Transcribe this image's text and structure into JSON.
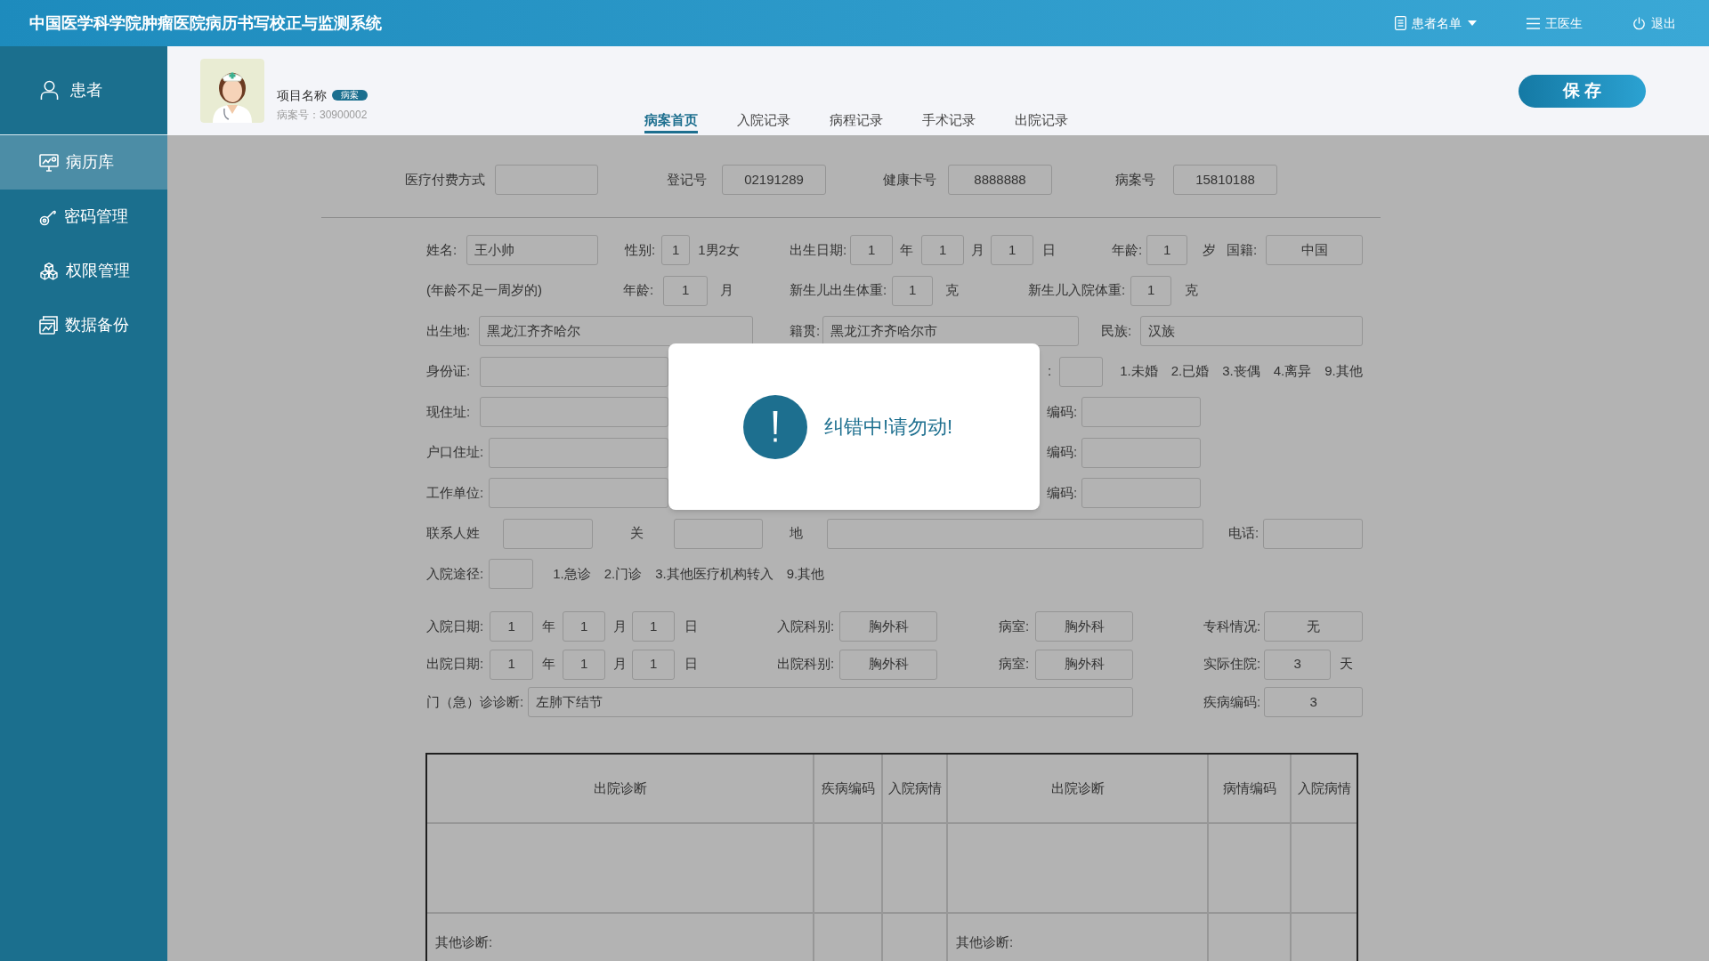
{
  "header": {
    "title": "中国医学科学院肿瘤医院病历书写校正与监测系统",
    "nav": [
      {
        "kind": "list",
        "label": "患者名单"
      },
      {
        "kind": "user",
        "label": "王医生"
      },
      {
        "kind": "logout",
        "label": "退出"
      }
    ]
  },
  "sidebar": {
    "top_link": {
      "label": "患者"
    },
    "items": [
      {
        "kind": "records",
        "label": "病历库",
        "selected": true
      },
      {
        "kind": "password",
        "label": "密码管理",
        "selected": false
      },
      {
        "kind": "permissions",
        "label": "权限管理",
        "selected": false
      },
      {
        "kind": "backup",
        "label": "数据备份",
        "selected": false
      }
    ]
  },
  "record": {
    "project_name": "项目名称",
    "tag": "病案",
    "case_number": "病案号：30900002"
  },
  "tabs": [
    {
      "label": "病案首页",
      "selected": true
    },
    {
      "label": "入院记录",
      "selected": false
    },
    {
      "label": "病程记录",
      "selected": false
    },
    {
      "label": "手术记录",
      "selected": false
    },
    {
      "label": "出院记录",
      "selected": false
    }
  ],
  "save_button": "保 存",
  "form": {
    "top_row": [
      {
        "label": "医疗付费方式",
        "parts": [
          {
            "kind": "input"
          }
        ]
      },
      {
        "label": "登记号",
        "parts": [
          {
            "kind": "input",
            "value": "02191289"
          }
        ]
      },
      {
        "label": "健康卡号",
        "parts": [
          {
            "kind": "input",
            "value": "8888888"
          }
        ]
      },
      {
        "label": "病案号",
        "parts": [
          {
            "kind": "input",
            "value": "15810188"
          }
        ]
      }
    ],
    "personal_rows": [
      [
        {
          "label": "姓名:",
          "parts": [
            {
              "kind": "input",
              "value": "王小帅"
            }
          ]
        },
        {
          "label": "性别:",
          "parts": [
            {
              "kind": "input",
              "value": "1"
            },
            {
              "kind": "text",
              "text": "1男2女"
            }
          ]
        },
        {
          "label": "出生日期:",
          "parts": [
            {
              "kind": "input",
              "value": "1"
            },
            {
              "kind": "text",
              "text": "年"
            },
            {
              "kind": "input",
              "value": "1"
            },
            {
              "kind": "text",
              "text": "月"
            },
            {
              "kind": "input",
              "value": "1"
            },
            {
              "kind": "text",
              "text": "日"
            }
          ]
        },
        {
          "label": "年龄:",
          "parts": [
            {
              "kind": "input",
              "value": "1"
            },
            {
              "kind": "text",
              "text": "岁"
            }
          ]
        },
        {
          "label": "国籍:",
          "parts": [
            {
              "kind": "input",
              "value": "中国"
            }
          ]
        }
      ],
      [
        {
          "parts": [
            {
              "kind": "text",
              "text": "(年龄不足一周岁的)"
            }
          ]
        },
        {
          "label": "年龄:",
          "parts": [
            {
              "kind": "input",
              "value": "1"
            },
            {
              "kind": "text",
              "text": "月"
            }
          ]
        },
        {
          "label": "新生儿出生体重:",
          "parts": [
            {
              "kind": "input",
              "value": "1"
            },
            {
              "kind": "text",
              "text": "克"
            }
          ]
        },
        {
          "label": "新生儿入院体重:",
          "parts": [
            {
              "kind": "input",
              "value": "1"
            },
            {
              "kind": "text",
              "text": "克"
            }
          ]
        }
      ],
      [
        {
          "label": "出生地:",
          "parts": [
            {
              "kind": "input",
              "value": "黑龙江齐齐哈尔"
            }
          ]
        },
        {
          "label": "籍贯:",
          "parts": [
            {
              "kind": "input",
              "value": "黑龙江齐齐哈尔市"
            }
          ]
        },
        {
          "label": "民族:",
          "parts": [
            {
              "kind": "input",
              "value": "汉族"
            }
          ]
        }
      ],
      [
        {
          "label": "身份证:",
          "parts": [
            {
              "kind": "input"
            }
          ]
        },
        {
          "label": ":",
          "parts": [
            {
              "kind": "input"
            },
            {
              "kind": "text",
              "text": "1.未婚"
            },
            {
              "kind": "text",
              "text": "2.已婚"
            },
            {
              "kind": "text",
              "text": "3.丧偶"
            },
            {
              "kind": "text",
              "text": "4.离异"
            },
            {
              "kind": "text",
              "text": "9.其他"
            }
          ]
        }
      ],
      [
        {
          "label": "现住址:",
          "parts": [
            {
              "kind": "input"
            }
          ]
        },
        {
          "label": "编码:",
          "parts": [
            {
              "kind": "input"
            }
          ]
        }
      ],
      [
        {
          "label": "户口住址:",
          "parts": [
            {
              "kind": "input"
            }
          ]
        },
        {
          "label": "编码:",
          "parts": [
            {
              "kind": "input"
            }
          ]
        }
      ],
      [
        {
          "label": "工作单位:",
          "parts": [
            {
              "kind": "input"
            }
          ]
        },
        {
          "label": "编码:",
          "parts": [
            {
              "kind": "input"
            }
          ]
        }
      ],
      [
        {
          "label": "联系人姓",
          "parts": [
            {
              "kind": "input"
            }
          ]
        },
        {
          "label": "关",
          "parts": [
            {
              "kind": "input"
            }
          ]
        },
        {
          "label": "地",
          "parts": [
            {
              "kind": "input"
            }
          ]
        },
        {
          "label": "电话:",
          "parts": [
            {
              "kind": "input"
            }
          ]
        }
      ],
      [
        {
          "label": "入院途径:",
          "parts": [
            {
              "kind": "input"
            },
            {
              "kind": "text",
              "text": "1.急诊"
            },
            {
              "kind": "text",
              "text": "2.门诊"
            },
            {
              "kind": "text",
              "text": "3.其他医疗机构转入"
            },
            {
              "kind": "text",
              "text": "9.其他"
            }
          ]
        }
      ]
    ],
    "admission_rows": [
      [
        {
          "label": "入院日期:",
          "parts": [
            {
              "kind": "input",
              "value": "1"
            },
            {
              "kind": "text",
              "text": "年"
            },
            {
              "kind": "input",
              "value": "1"
            },
            {
              "kind": "text",
              "text": "月"
            },
            {
              "kind": "input",
              "value": "1"
            },
            {
              "kind": "text",
              "text": "日"
            }
          ]
        },
        {
          "label": "入院科别:",
          "parts": [
            {
              "kind": "input",
              "value": "胸外科"
            }
          ]
        },
        {
          "label": "病室:",
          "parts": [
            {
              "kind": "input",
              "value": "胸外科"
            }
          ]
        },
        {
          "label": "专科情况:",
          "parts": [
            {
              "kind": "input",
              "value": "无"
            }
          ]
        }
      ],
      [
        {
          "label": "出院日期:",
          "parts": [
            {
              "kind": "input",
              "value": "1"
            },
            {
              "kind": "text",
              "text": "年"
            },
            {
              "kind": "input",
              "value": "1"
            },
            {
              "kind": "text",
              "text": "月"
            },
            {
              "kind": "input",
              "value": "1"
            },
            {
              "kind": "text",
              "text": "日"
            }
          ]
        },
        {
          "label": "出院科别:",
          "parts": [
            {
              "kind": "input",
              "value": "胸外科"
            }
          ]
        },
        {
          "label": "病室:",
          "parts": [
            {
              "kind": "input",
              "value": "胸外科"
            }
          ]
        },
        {
          "label": "实际住院:",
          "parts": [
            {
              "kind": "input",
              "value": "3"
            },
            {
              "kind": "text",
              "text": "天"
            }
          ]
        }
      ],
      [
        {
          "label": "门（急）诊诊断:",
          "parts": [
            {
              "kind": "input",
              "value": "左肺下结节"
            }
          ]
        },
        {
          "label": "疾病编码:",
          "parts": [
            {
              "kind": "input",
              "value": "3"
            }
          ]
        }
      ]
    ]
  },
  "diagnosis_table": {
    "columns": [
      "出院诊断",
      "疾病编码",
      "入院病情",
      "出院诊断",
      "病情编码",
      "入院病情"
    ],
    "rows": [
      [
        null,
        null,
        null,
        null,
        null,
        null
      ],
      [
        "其他诊断:",
        null,
        null,
        "其他诊断:",
        null,
        null
      ]
    ]
  },
  "dialog": {
    "message": "纠错中!请勿动!"
  }
}
